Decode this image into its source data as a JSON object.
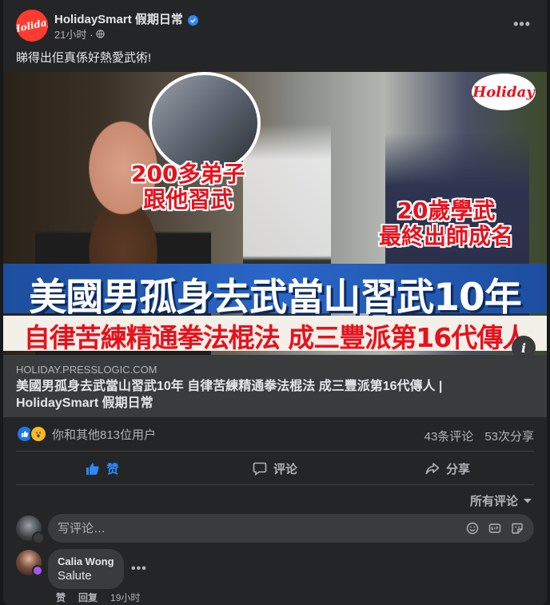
{
  "post": {
    "page_name": "HolidaySmart 假期日常",
    "timestamp": "21小时 ·",
    "text": "睇得出佢真係好熱愛武術!",
    "image": {
      "bubble1": "200多弟子\n跟他習武",
      "bubble2": "20歲學武\n最終出師成名",
      "logo": "Holiday",
      "headline": "美國男孤身去武當山習武10年",
      "subline": "自律苦練精通拳法棍法 成三豐派第16代傳人",
      "info_icon": "i"
    },
    "link": {
      "domain": "HOLIDAY.PRESSLOGIC.COM",
      "title": "美國男孤身去武當山習武10年 自律苦練精通拳法棍法 成三豐派第16代傳人 | HolidaySmart 假期日常"
    },
    "reactions_text": "你和其他813位用户",
    "comments_count": "43条评论",
    "shares_count": "53次分享"
  },
  "actions": {
    "like": "赞",
    "comment": "评论",
    "share": "分享"
  },
  "comments": {
    "sort_label": "所有评论",
    "input_placeholder": "写评论…",
    "items": [
      {
        "author": "Calia Wong",
        "text": "Salute",
        "like": "赞",
        "reply": "回复",
        "time": "19小时"
      }
    ]
  },
  "colors": {
    "background": "#18191a",
    "card": "#242526",
    "accent_blue": "#2d88ff",
    "brand_red": "#e8111c"
  }
}
